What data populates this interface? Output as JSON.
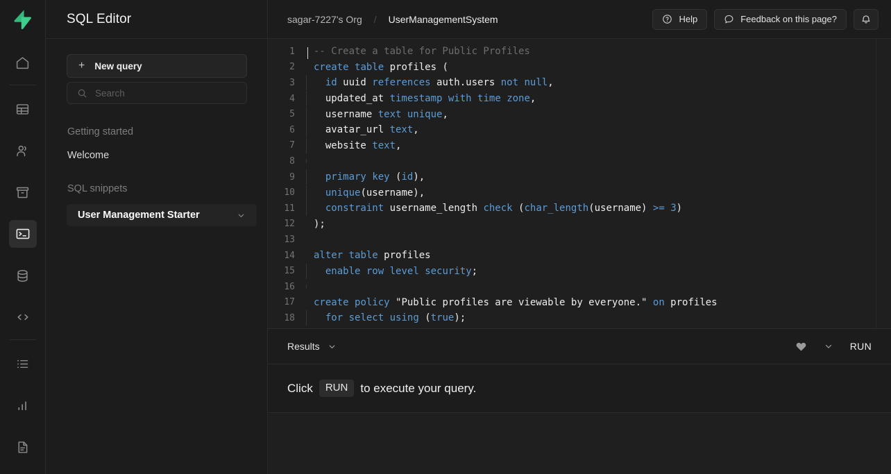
{
  "brand": {
    "logo_icon": "supabase-logo",
    "accent_color": "#3ECF8E"
  },
  "rail": {
    "items": [
      {
        "icon": "home-icon",
        "name": "home"
      },
      {
        "icon": "table-editor-icon",
        "name": "table-editor"
      },
      {
        "icon": "authentication-icon",
        "name": "authentication"
      },
      {
        "icon": "storage-icon",
        "name": "storage"
      },
      {
        "icon": "sql-editor-icon",
        "name": "sql-editor",
        "active": true
      },
      {
        "icon": "database-icon",
        "name": "database"
      },
      {
        "icon": "api-code-icon",
        "name": "api"
      },
      {
        "icon": "logs-list-icon",
        "name": "logs"
      },
      {
        "icon": "reports-chart-icon",
        "name": "reports"
      },
      {
        "icon": "documents-icon",
        "name": "documents"
      }
    ]
  },
  "sidebar": {
    "title": "SQL Editor",
    "new_query_label": "New query",
    "new_query_icon": "plus-icon",
    "search": {
      "placeholder": "Search",
      "value": "",
      "icon": "search-icon"
    },
    "getting_started_label": "Getting started",
    "welcome_label": "Welcome",
    "sql_snippets_label": "SQL snippets",
    "snippet_label": "User Management Starter",
    "snippet_chevron_icon": "chevron-down-icon"
  },
  "topbar": {
    "org": "sagar-7227's Org",
    "separator": "/",
    "project": "UserManagementSystem",
    "help_label": "Help",
    "help_icon": "question-circle-icon",
    "feedback_label": "Feedback on this page?",
    "feedback_icon": "chat-bubble-icon",
    "notifications_icon": "bell-icon"
  },
  "editor": {
    "lines": [
      {
        "n": "1",
        "tokens": [
          {
            "t": "-- Create a table for Public Profiles",
            "c": "cm"
          }
        ],
        "indent": false,
        "caret": true
      },
      {
        "n": "2",
        "tokens": [
          {
            "t": "create",
            "c": "kw"
          },
          {
            "t": " "
          },
          {
            "t": "table",
            "c": "kw"
          },
          {
            "t": " profiles ("
          }
        ],
        "indent": false
      },
      {
        "n": "3",
        "tokens": [
          {
            "t": "  "
          },
          {
            "t": "id",
            "c": "kw"
          },
          {
            "t": " uuid "
          },
          {
            "t": "references",
            "c": "kw"
          },
          {
            "t": " auth.users "
          },
          {
            "t": "not",
            "c": "kw"
          },
          {
            "t": " "
          },
          {
            "t": "null",
            "c": "kw"
          },
          {
            "t": ","
          }
        ],
        "indent": true
      },
      {
        "n": "4",
        "tokens": [
          {
            "t": "  updated_at "
          },
          {
            "t": "timestamp",
            "c": "kw"
          },
          {
            "t": " "
          },
          {
            "t": "with",
            "c": "kw"
          },
          {
            "t": " "
          },
          {
            "t": "time",
            "c": "kw"
          },
          {
            "t": " "
          },
          {
            "t": "zone",
            "c": "kw"
          },
          {
            "t": ","
          }
        ],
        "indent": true
      },
      {
        "n": "5",
        "tokens": [
          {
            "t": "  username "
          },
          {
            "t": "text",
            "c": "kw"
          },
          {
            "t": " "
          },
          {
            "t": "unique",
            "c": "kw"
          },
          {
            "t": ","
          }
        ],
        "indent": true
      },
      {
        "n": "6",
        "tokens": [
          {
            "t": "  avatar_url "
          },
          {
            "t": "text",
            "c": "kw"
          },
          {
            "t": ","
          }
        ],
        "indent": true
      },
      {
        "n": "7",
        "tokens": [
          {
            "t": "  website "
          },
          {
            "t": "text",
            "c": "kw"
          },
          {
            "t": ","
          }
        ],
        "indent": true
      },
      {
        "n": "8",
        "tokens": [
          {
            "t": ""
          }
        ],
        "indent": true
      },
      {
        "n": "9",
        "tokens": [
          {
            "t": "  "
          },
          {
            "t": "primary",
            "c": "kw"
          },
          {
            "t": " "
          },
          {
            "t": "key",
            "c": "kw"
          },
          {
            "t": " ("
          },
          {
            "t": "id",
            "c": "kw"
          },
          {
            "t": "),"
          }
        ],
        "indent": true
      },
      {
        "n": "10",
        "tokens": [
          {
            "t": "  "
          },
          {
            "t": "unique",
            "c": "kw"
          },
          {
            "t": "(username),"
          }
        ],
        "indent": true
      },
      {
        "n": "11",
        "tokens": [
          {
            "t": "  "
          },
          {
            "t": "constraint",
            "c": "kw"
          },
          {
            "t": " username_length "
          },
          {
            "t": "check",
            "c": "kw"
          },
          {
            "t": " ("
          },
          {
            "t": "char_length",
            "c": "kw"
          },
          {
            "t": "(username) "
          },
          {
            "t": ">=",
            "c": "kw"
          },
          {
            "t": " "
          },
          {
            "t": "3",
            "c": "kw"
          },
          {
            "t": ")"
          }
        ],
        "indent": true
      },
      {
        "n": "12",
        "tokens": [
          {
            "t": ");"
          }
        ],
        "indent": false
      },
      {
        "n": "13",
        "tokens": [
          {
            "t": ""
          }
        ],
        "indent": false
      },
      {
        "n": "14",
        "tokens": [
          {
            "t": "alter",
            "c": "kw"
          },
          {
            "t": " "
          },
          {
            "t": "table",
            "c": "kw"
          },
          {
            "t": " profiles"
          }
        ],
        "indent": false
      },
      {
        "n": "15",
        "tokens": [
          {
            "t": "  "
          },
          {
            "t": "enable",
            "c": "kw"
          },
          {
            "t": " "
          },
          {
            "t": "row",
            "c": "kw"
          },
          {
            "t": " "
          },
          {
            "t": "level",
            "c": "kw"
          },
          {
            "t": " "
          },
          {
            "t": "security",
            "c": "kw"
          },
          {
            "t": ";"
          }
        ],
        "indent": true
      },
      {
        "n": "16",
        "tokens": [
          {
            "t": ""
          }
        ],
        "indent": true
      },
      {
        "n": "17",
        "tokens": [
          {
            "t": "create",
            "c": "kw"
          },
          {
            "t": " "
          },
          {
            "t": "policy",
            "c": "kw"
          },
          {
            "t": " \"Public profiles are viewable by everyone.\" "
          },
          {
            "t": "on",
            "c": "kw"
          },
          {
            "t": " profiles"
          }
        ],
        "indent": false
      },
      {
        "n": "18",
        "tokens": [
          {
            "t": "  "
          },
          {
            "t": "for",
            "c": "kw"
          },
          {
            "t": " "
          },
          {
            "t": "select",
            "c": "kw"
          },
          {
            "t": " "
          },
          {
            "t": "using",
            "c": "kw"
          },
          {
            "t": " ("
          },
          {
            "t": "true",
            "c": "kw"
          },
          {
            "t": ");"
          }
        ],
        "indent": true
      }
    ]
  },
  "results": {
    "tab_label": "Results",
    "tab_chevron_icon": "chevron-down-icon",
    "favorite_icon": "heart-icon",
    "more_chevron_icon": "chevron-down-icon",
    "run_label": "RUN",
    "hint_prefix": "Click",
    "hint_key": "RUN",
    "hint_suffix": "to execute your query."
  }
}
